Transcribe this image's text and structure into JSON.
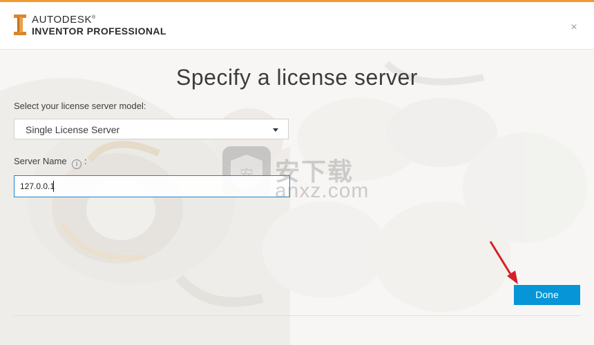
{
  "header": {
    "brand_top": "AUTODESK",
    "brand_bottom": "INVENTOR PROFESSIONAL",
    "registered_mark": "®",
    "close_label": "×",
    "accent_color": "#f29a32"
  },
  "main": {
    "title": "Specify a license server",
    "model_label": "Select your license server model:",
    "model_selected": "Single License Server",
    "server_name_label": "Server Name",
    "server_name_suffix": ":",
    "info_glyph": "i",
    "server_name_value": "127.0.0.1",
    "done_label": "Done",
    "button_color": "#0696d7"
  },
  "watermark": {
    "cn_text": "安下载",
    "url_text": "anxz.com"
  },
  "icons": {
    "logo": "inventor-logo-icon",
    "close": "close-icon",
    "info": "info-icon",
    "dropdown": "chevron-down-icon",
    "annotation": "red-arrow-icon",
    "watermark_shield": "shield-icon"
  }
}
